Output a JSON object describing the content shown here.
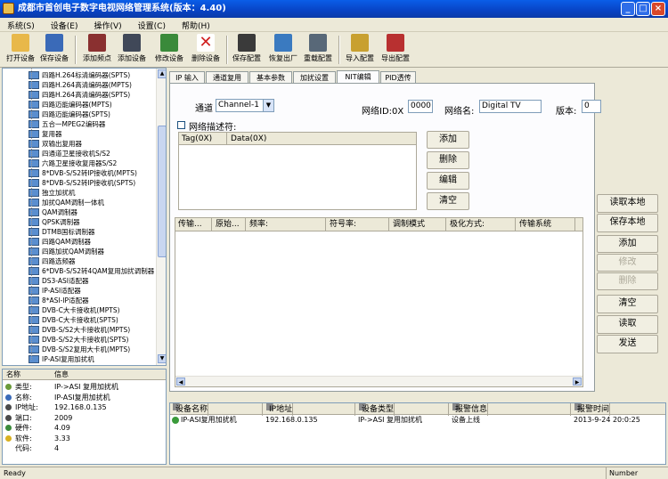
{
  "window": {
    "title": "成都市首创电子数字电视网络管理系统(版本：4.40)",
    "min_icon": "minimize-icon",
    "max_icon": "maximize-icon",
    "close_icon": "close-icon",
    "min_glyph": "_",
    "max_glyph": "□",
    "close_glyph": "×"
  },
  "menu": [
    "系统(S)",
    "设备(E)",
    "操作(V)",
    "设置(C)",
    "帮助(H)"
  ],
  "toolbar": [
    {
      "label": "打开设备",
      "icon": "folder-open-icon",
      "color": "#e8b84a"
    },
    {
      "label": "保存设备",
      "icon": "floppy-disk-icon",
      "color": "#3a6ab8"
    },
    {
      "label": "添加频点",
      "icon": "add-frequency-icon",
      "color": "#8a3030"
    },
    {
      "label": "添加设备",
      "icon": "add-device-icon",
      "color": "#404858"
    },
    {
      "label": "修改设备",
      "icon": "edit-device-icon",
      "color": "#3a8a3a"
    },
    {
      "label": "删除设备",
      "icon": "delete-x-icon",
      "color": "#d02020"
    },
    {
      "label": "保存配置",
      "icon": "save-config-icon",
      "color": "#3a3a3a"
    },
    {
      "label": "恢复出厂",
      "icon": "factory-reset-icon",
      "color": "#3a7ac0"
    },
    {
      "label": "重载配置",
      "icon": "reload-config-icon",
      "color": "#586878"
    },
    {
      "label": "导入配置",
      "icon": "import-config-icon",
      "color": "#c8a030"
    },
    {
      "label": "导出配置",
      "icon": "export-config-icon",
      "color": "#b83030"
    }
  ],
  "tree": [
    "四路H.264标清编码器(SPTS)",
    "四路H.264高清编码器(MPTS)",
    "四路H.264高清编码器(SPTS)",
    "四路迈能编码器(MPTS)",
    "四路迈能编码器(SPTS)",
    "五合一MPEG2编码器",
    "复用器",
    "双输出复用器",
    "四通道卫星接收机S/S2",
    "六路卫星接收复用器S/S2",
    "8*DVB-S/S2转IP接收机(MPTS)",
    "8*DVB-S/S2转IP接收机(SPTS)",
    "独立加扰机",
    "加扰QAM调制一体机",
    "QAM调制器",
    "QPSK调制器",
    "DTMB国标调制器",
    "四路QAM调制器",
    "四路加扰QAM调制器",
    "四路选频器",
    "6*DVB-S/S2转4QAM复用加扰调制器",
    "DS3-ASI适配器",
    "IP-ASI适配器",
    "8*ASI-IP适配器",
    "DVB-C大卡接收机(MPTS)",
    "DVB-C大卡接收机(SPTS)",
    "DVB-S/S2大卡接收机(MPTS)",
    "DVB-S/S2大卡接收机(SPTS)",
    "DVB-S/S2复用大卡机(MPTS)",
    "IP-ASI复用加扰机"
  ],
  "props": {
    "col_name": "名称",
    "col_info": "信息",
    "rows": [
      {
        "k": "类型:",
        "v": "IP->ASI 复用加扰机",
        "color": "#6a9a3a"
      },
      {
        "k": "名称:",
        "v": "IP-ASI复用加扰机",
        "color": "#3a6ab8"
      },
      {
        "k": "IP地址:",
        "v": "192.168.0.135",
        "color": "#4a4a4a"
      },
      {
        "k": "端口:",
        "v": "2009",
        "color": "#4a4a4a"
      },
      {
        "k": "硬件:",
        "v": "4.09",
        "color": "#3a8a3a"
      },
      {
        "k": "软件:",
        "v": "3.33",
        "color": "#d8b020"
      },
      {
        "k": "代码:",
        "v": "4",
        "color": "#ffffff"
      }
    ]
  },
  "tabs": [
    "IP 输入",
    "通道复用",
    "基本参数",
    "加扰设置",
    "NIT编辑",
    "PID透传"
  ],
  "nit": {
    "channel_label": "通道",
    "channel_value": "Channel-1",
    "network_id_label": "网络ID:0X",
    "network_id_value": "0000",
    "network_name_label": "网络名:",
    "network_name_value": "Digital TV",
    "version_label": "版本:",
    "version_value": "0",
    "descriptor_label": "网络描述符:",
    "desc_cols": [
      "Tag(0X)",
      "Data(0X)"
    ],
    "desc_buttons": [
      "添加",
      "删除",
      "编辑",
      "清空"
    ],
    "ts_cols": [
      "传输...",
      "原始...",
      "频率:",
      "符号率:",
      "调制模式",
      "极化方式:",
      "传输系统"
    ],
    "side_buttons": [
      {
        "label": "读取本地",
        "enabled": true
      },
      {
        "label": "保存本地",
        "enabled": true
      },
      {
        "label": "添加",
        "enabled": true
      },
      {
        "label": "修改",
        "enabled": false
      },
      {
        "label": "删除",
        "enabled": false
      },
      {
        "label": "清空",
        "enabled": true
      },
      {
        "label": "读取",
        "enabled": true
      },
      {
        "label": "发送",
        "enabled": true
      }
    ]
  },
  "log": {
    "cols": [
      "设备名称",
      "IP地址",
      "设备类型",
      "报警信息",
      "报警时间"
    ],
    "rows": [
      {
        "name": "IP-ASI复用加扰机",
        "ip": "192.168.0.135",
        "type": "IP->ASI 复用加扰机",
        "info": "设备上线",
        "time": "2013-9-24 20:0:25"
      }
    ]
  },
  "status": {
    "left": "Ready",
    "right": "Number"
  }
}
